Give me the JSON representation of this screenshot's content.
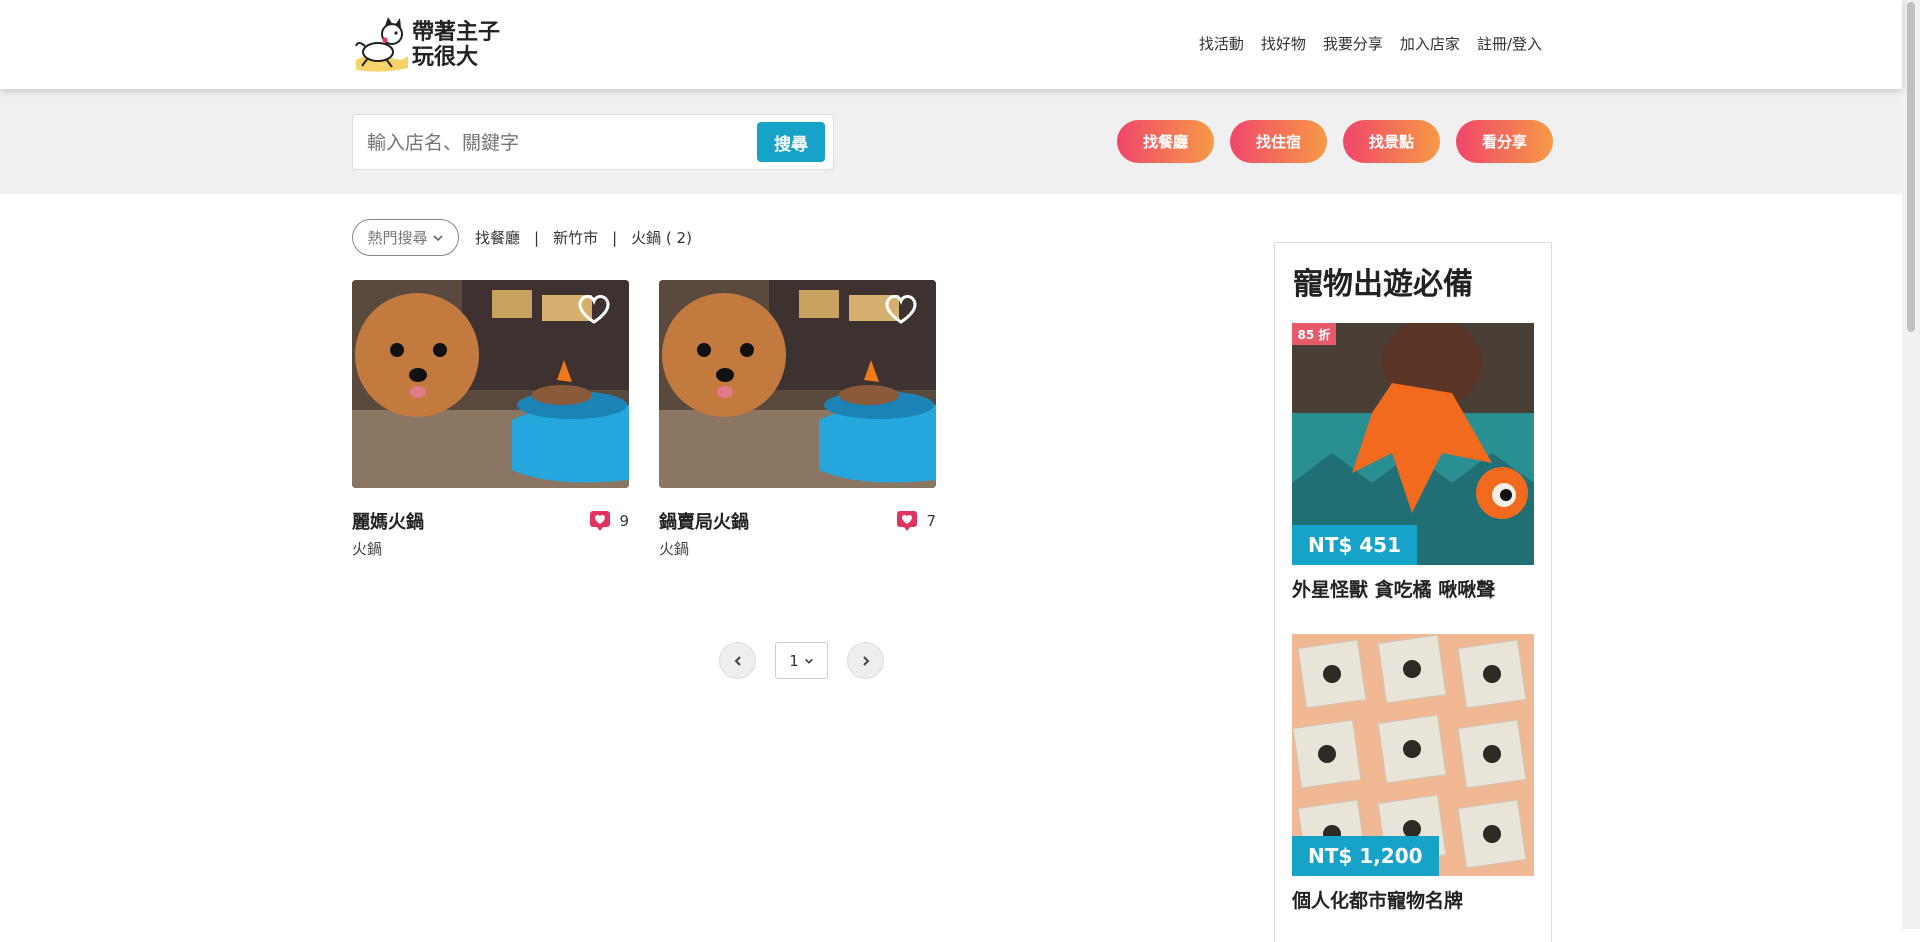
{
  "logo": {
    "text": "帶著主子玩很大"
  },
  "nav": {
    "items": [
      "找活動",
      "找好物",
      "我要分享",
      "加入店家",
      "註冊/登入"
    ]
  },
  "search": {
    "placeholder": "輸入店名、關鍵字",
    "button": "搜尋"
  },
  "quick_links": [
    "找餐廳",
    "找住宿",
    "找景點",
    "看分享"
  ],
  "breadcrumb": {
    "hot_search": "熱門搜尋",
    "category": "找餐廳",
    "city": "新竹市",
    "tag": "火鍋 ( 2)",
    "separator": "|"
  },
  "results": [
    {
      "title": "麗媽火鍋",
      "category": "火鍋",
      "likes": "9"
    },
    {
      "title": "鍋賣局火鍋",
      "category": "火鍋",
      "likes": "7"
    }
  ],
  "pagination": {
    "current": "1"
  },
  "sidebar": {
    "title": "寵物出遊必備",
    "products": [
      {
        "name": "外星怪獸 貪吃橘 啾啾聲",
        "price": "NT$ 451",
        "badge": "85 折"
      },
      {
        "name": "個人化都市寵物名牌",
        "price": "NT$ 1,200",
        "badge": ""
      }
    ]
  },
  "colors": {
    "accent": "#17a2c7",
    "pill_start": "#f0466b",
    "pill_end": "#f79a46",
    "heart": "#e0335f"
  }
}
